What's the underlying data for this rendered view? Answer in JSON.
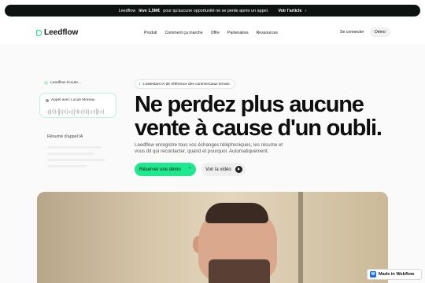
{
  "announcement": {
    "prefix": "Leedflow",
    "bold": "lève 1,5M€",
    "rest": "pour qu'aucune opportunité ne se perde après un appel.",
    "link": "Voir l'article"
  },
  "brand": {
    "name": "Leedflow",
    "accent": "#1ee98f"
  },
  "nav": {
    "items": [
      "Produit",
      "Comment ça marche",
      "Offre",
      "Partenaires",
      "Ressources"
    ],
    "login": "Se connecter",
    "demo": "Démo"
  },
  "card": {
    "listening": "Leedflow écoute...",
    "call_title": "Appel avec Lucas Moreau",
    "summary": "Résumé d'appel IA"
  },
  "hero": {
    "badge": "L'assistant IA de référence des commerciaux terrain.",
    "headline_line1": "Ne perdez plus aucune",
    "headline_line2": "vente à cause d'un oubli.",
    "subtext": "Leedflow enregistre tous vos échanges téléphoniques, les résume et vous dit qui recontacter, quand et pourquoi. Automatiquement.",
    "cta": "Réserver une démo",
    "video": "Voir la vidéo"
  },
  "webflow_badge": "Made in Webflow"
}
